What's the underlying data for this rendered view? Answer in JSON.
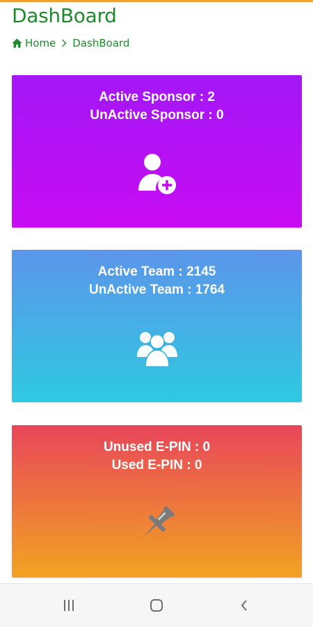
{
  "header": {
    "title": "DashBoard",
    "breadcrumb": {
      "home_label": "Home",
      "current_label": "DashBoard"
    }
  },
  "cards": {
    "sponsor": {
      "line1": "Active Sponsor : 2",
      "line2": "UnActive Sponsor : 0",
      "icon": "add-user-icon"
    },
    "team": {
      "line1": "Active Team : 2145",
      "line2": "UnActive Team : 1764",
      "icon": "users-icon"
    },
    "epin": {
      "line1": "Unused E-PIN : 0",
      "line2": "Used E-PIN : 0",
      "icon": "thumbtack-icon"
    }
  },
  "navbar": {
    "recents": "recents-icon",
    "home": "home-circle-icon",
    "back": "back-icon"
  },
  "colors": {
    "accent_green": "#1f8a2e",
    "top_bar": "#f0a030",
    "sponsor_gradient": [
      "#a317f7",
      "#c80cf3"
    ],
    "team_gradient": [
      "#5b95ea",
      "#2fc9e1"
    ],
    "epin_gradient": [
      "#e8465a",
      "#f2a322"
    ]
  }
}
